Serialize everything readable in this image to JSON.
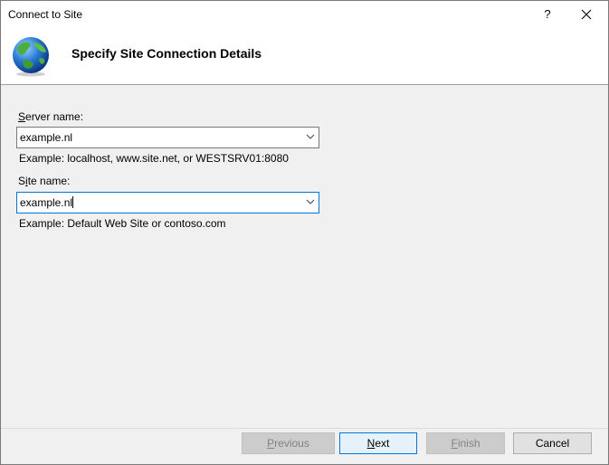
{
  "window": {
    "title": "Connect to Site",
    "help_label": "?",
    "close_icon": "close-icon"
  },
  "header": {
    "icon": "globe-icon",
    "title": "Specify Site Connection Details"
  },
  "form": {
    "server_name": {
      "label_accel": "S",
      "label_rest": "erver name:",
      "value": "example.nl",
      "hint": "Example: localhost, www.site.net, or WESTSRV01:8080"
    },
    "site_name": {
      "label_pre": "S",
      "label_accel": "i",
      "label_rest": "te name:",
      "value": "example.nl",
      "hint": "Example: Default Web Site or contoso.com"
    }
  },
  "buttons": {
    "previous": {
      "accel": "P",
      "rest": "revious"
    },
    "next": {
      "accel": "N",
      "rest": "ext"
    },
    "finish": {
      "accel": "F",
      "rest": "inish"
    },
    "cancel": {
      "label": "Cancel"
    }
  }
}
